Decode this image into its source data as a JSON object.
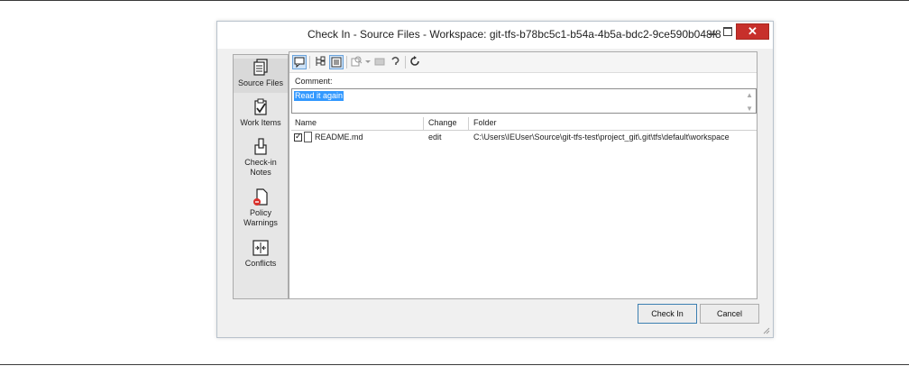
{
  "window": {
    "title": "Check In - Source Files - Workspace: git-tfs-b78bc5c1-b54a-4b5a-bdc2-9ce590b048f8",
    "controls": {
      "minimize": "–",
      "maximize": "□",
      "close": "✕"
    }
  },
  "sidebar": {
    "items": [
      {
        "label": "Source Files",
        "icon": "source-files-icon",
        "selected": true
      },
      {
        "label": "Work Items",
        "icon": "work-items-icon",
        "selected": false
      },
      {
        "label": "Check-in Notes",
        "icon": "check-in-notes-icon",
        "selected": false
      },
      {
        "label": "Policy Warnings",
        "icon": "policy-warnings-icon",
        "selected": false
      },
      {
        "label": "Conflicts",
        "icon": "conflicts-icon",
        "selected": false
      }
    ]
  },
  "toolbar": {
    "icons": [
      "comment-icon",
      "tree-view-icon",
      "flat-view-icon",
      "compare-icon",
      "dropdown-arrow-icon",
      "shelve-icon",
      "undo-icon",
      "refresh-icon"
    ]
  },
  "comment": {
    "label": "Comment:",
    "value": "Read it again"
  },
  "files": {
    "columns": [
      "Name",
      "Change",
      "Folder"
    ],
    "rows": [
      {
        "name": "README.md",
        "change": "edit",
        "folder": "C:\\Users\\IEUser\\Source\\git-tfs-test\\project_git\\.git\\tfs\\default\\workspace",
        "checked": true
      }
    ]
  },
  "buttons": {
    "check_in": "Check In",
    "cancel": "Cancel"
  }
}
